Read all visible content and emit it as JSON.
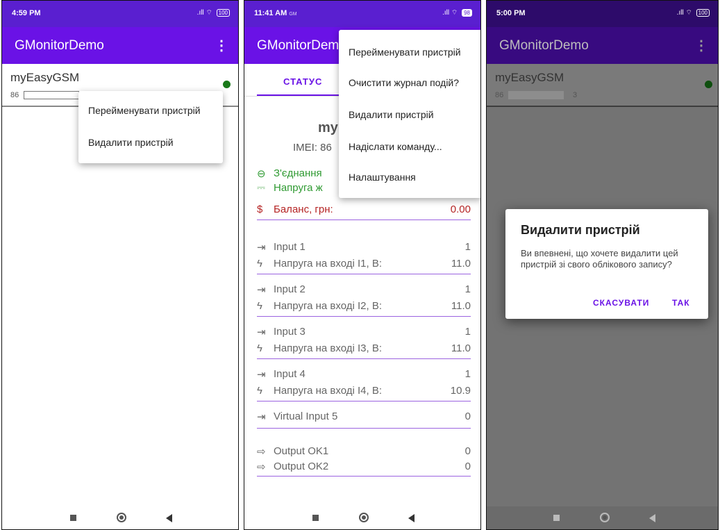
{
  "screens": [
    {
      "status_time": "4:59 PM",
      "battery": "100",
      "app_title": "GMonitorDemo",
      "device": {
        "name": "myEasyGSM",
        "sub": "86"
      },
      "menu": [
        "Перейменувати пристрій",
        "Видалити пристрій"
      ]
    },
    {
      "status_time": "11:41 AM",
      "status_extra": "GM",
      "battery": "98",
      "app_title": "GMonitorDem",
      "tab": "СТАТУС",
      "device_title": "my",
      "imei": "IMEI: 86",
      "rows": {
        "connection": "З'єднання",
        "voltage": "Напруга ж",
        "balance_label": "Баланс, грн:",
        "balance_value": "0.00",
        "inputs": [
          {
            "name": "Input 1",
            "state": "1",
            "vlabel": "Напруга на вході I1, В:",
            "volt": "11.0"
          },
          {
            "name": "Input 2",
            "state": "1",
            "vlabel": "Напруга на вході I2, В:",
            "volt": "11.0"
          },
          {
            "name": "Input 3",
            "state": "1",
            "vlabel": "Напруга на вході I3, В:",
            "volt": "11.0"
          },
          {
            "name": "Input 4",
            "state": "1",
            "vlabel": "Напруга на вході I4, В:",
            "volt": "10.9"
          }
        ],
        "virtual_input": {
          "name": "Virtual Input 5",
          "state": "0"
        },
        "outputs": [
          {
            "name": "Output OK1",
            "state": "0"
          },
          {
            "name": "Output OK2",
            "state": "0"
          }
        ]
      },
      "menu": [
        "Перейменувати пристрій",
        "Очистити журнал подій?",
        "Видалити пристрій",
        "Надіслати команду...",
        "Налаштування"
      ]
    },
    {
      "status_time": "5:00 PM",
      "battery": "100",
      "app_title": "GMonitorDemo",
      "device": {
        "name": "myEasyGSM",
        "sub": "86",
        "sub_end": "3"
      },
      "dialog": {
        "title": "Видалити пристрій",
        "message": "Ви впевнені, що хочете видалити цей пристрій зі свого облікового запису?",
        "cancel": "СКАСУВАТИ",
        "ok": "ТАК"
      }
    }
  ],
  "colors": {
    "primary": "#6a12e6",
    "status_bar": "#5a1fd0",
    "online_dot": "#1a7a1a",
    "green": "#2f9a32",
    "red": "#b52424"
  }
}
